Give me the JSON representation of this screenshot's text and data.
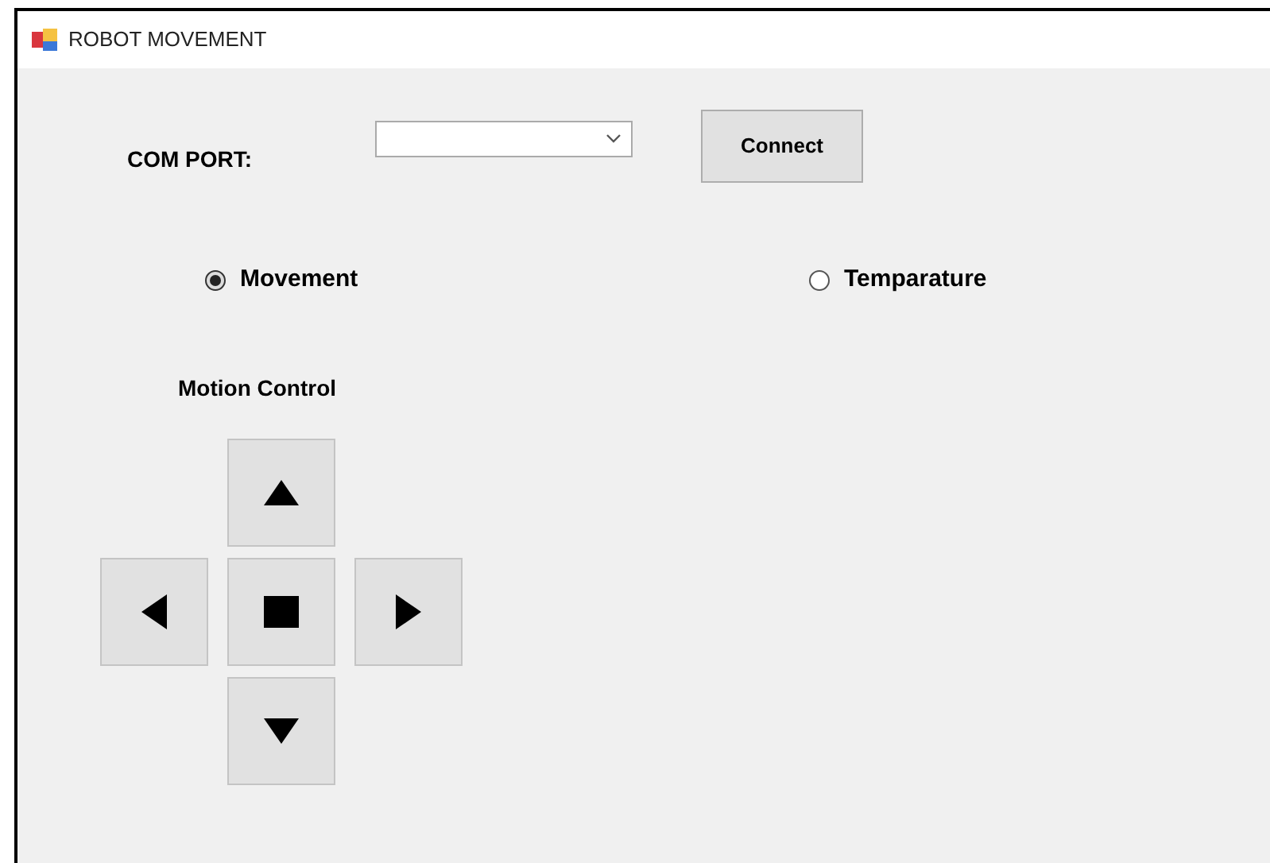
{
  "window": {
    "title": "ROBOT MOVEMENT"
  },
  "com_port": {
    "label": "COM PORT:"
  },
  "connect_button": {
    "label": "Connect"
  },
  "modes": [
    {
      "label": "Movement",
      "selected": true
    },
    {
      "label": "Temparature",
      "selected": false
    }
  ],
  "motion_control": {
    "title": "Motion Control",
    "buttons": [
      {
        "kind": "up"
      },
      {
        "kind": "left"
      },
      {
        "kind": "stop"
      },
      {
        "kind": "right"
      },
      {
        "kind": "down"
      }
    ]
  }
}
